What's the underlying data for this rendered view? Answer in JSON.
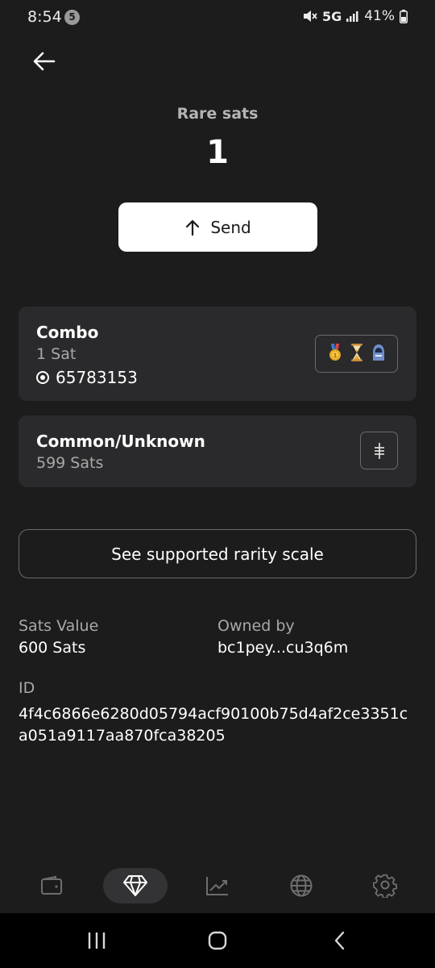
{
  "status_bar": {
    "time": "8:54",
    "notification_count": "5",
    "network": "5G",
    "battery": "41%"
  },
  "header": {
    "label": "Rare sats",
    "count": "1"
  },
  "send_button": {
    "label": "Send"
  },
  "cards": [
    {
      "title": "Combo",
      "subtitle": "1 Sat",
      "block": "65783153",
      "rarity_icons": [
        "gold-medal-icon",
        "hourglass-icon",
        "hooded-figure-icon"
      ]
    },
    {
      "title": "Common/Unknown",
      "subtitle": "599 Sats"
    }
  ],
  "rarity_scale_button": {
    "label": "See supported rarity scale"
  },
  "info": {
    "sats_value_label": "Sats Value",
    "sats_value": "600 Sats",
    "owned_by_label": "Owned by",
    "owned_by": "bc1pey...cu3q6m",
    "id_label": "ID",
    "id": "4f4c6866e6280d05794acf90100b75d4af2ce3351ca051a9117aa870fca38205"
  },
  "bottom_nav": {
    "items": [
      "wallet-icon",
      "diamond-icon",
      "chart-icon",
      "globe-icon",
      "settings-icon"
    ],
    "active": "diamond-icon"
  },
  "colors": {
    "background": "#1c1c1c",
    "card": "#2a2a2c",
    "muted_text": "#a8a8a8"
  }
}
